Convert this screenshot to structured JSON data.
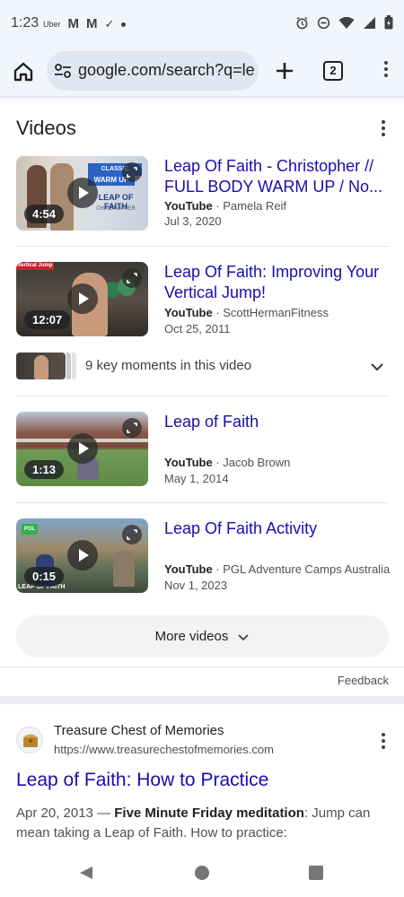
{
  "status_bar": {
    "time": "1:23",
    "apps": [
      "Uber",
      "M",
      "M",
      "✓"
    ]
  },
  "browser": {
    "url": "google.com/search?q=le",
    "tab_count": "2"
  },
  "videos": {
    "title": "Videos",
    "items": [
      {
        "title": "Leap Of Faith - Christopher // FULL BODY WARM UP / No...",
        "platform": "YouTube",
        "channel": " · Pamela Reif",
        "date": "Jul 3, 2020",
        "duration": "4:54",
        "thumb_texts": [
          "CLASSIC",
          "WARM UP",
          "LEAP OF FAITH",
          "CHRISTOPHER"
        ]
      },
      {
        "title": "Leap Of Faith: Improving Your Vertical Jump!",
        "platform": "YouTube",
        "channel": " · ScottHermanFitness",
        "date": "Oct 25, 2011",
        "duration": "12:07",
        "thumb_texts": [
          "Vertical Jump"
        ]
      },
      {
        "title": "Leap of Faith",
        "platform": "YouTube",
        "channel": " · Jacob Brown",
        "date": "May 1, 2014",
        "duration": "1:13",
        "thumb_texts": []
      },
      {
        "title": "Leap Of Faith Activity",
        "platform": "YouTube",
        "channel": " · PGL Adventure Camps Australia",
        "date": "Nov 1, 2023",
        "duration": "0:15",
        "thumb_texts": [
          "PGL",
          "LEAP OF FAITH"
        ]
      }
    ],
    "key_moments": "9 key moments in this video",
    "more_label": "More videos"
  },
  "feedback": "Feedback",
  "result": {
    "site": "Treasure Chest of Memories",
    "url": "https://www.treasurechestofmemories.com",
    "title": "Leap of Faith: How to Practice",
    "snippet_date": "Apr 20, 2013 — ",
    "snippet_bold": "Five Minute Friday meditation",
    "snippet_rest": ": Jump can mean taking a Leap of Faith. How to practice:"
  }
}
